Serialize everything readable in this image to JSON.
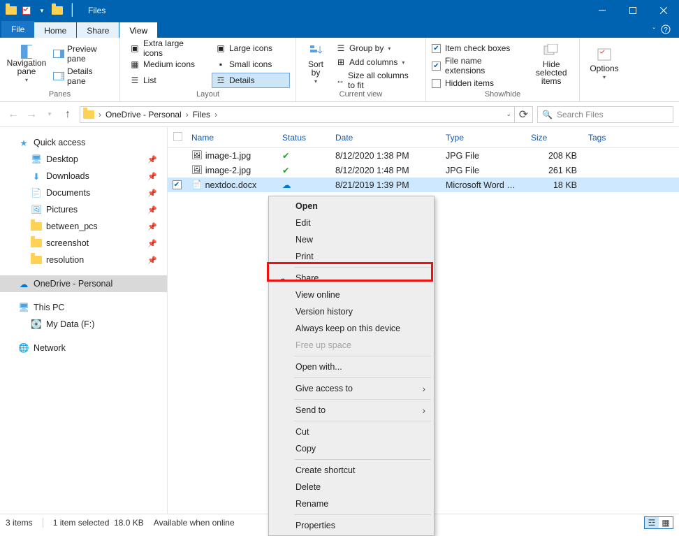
{
  "title": "Files",
  "tabs": {
    "file": "File",
    "home": "Home",
    "share": "Share",
    "view": "View"
  },
  "ribbon": {
    "panes": {
      "nav": "Navigation pane",
      "preview": "Preview pane",
      "details": "Details pane",
      "group": "Panes"
    },
    "layout": {
      "xl": "Extra large icons",
      "l": "Large icons",
      "m": "Medium icons",
      "s": "Small icons",
      "list": "List",
      "details": "Details",
      "group": "Layout"
    },
    "sort": {
      "btn": "Sort by",
      "group": "Current view",
      "groupby": "Group by",
      "addcols": "Add columns",
      "sizeall": "Size all columns to fit"
    },
    "show": {
      "itemcheck": "Item check boxes",
      "ext": "File name extensions",
      "hidden": "Hidden items",
      "hidesel": "Hide selected items",
      "group": "Show/hide"
    },
    "options": "Options"
  },
  "breadcrumb": {
    "root": "OneDrive - Personal",
    "folder": "Files"
  },
  "search": {
    "placeholder": "Search Files"
  },
  "nav": {
    "quick": "Quick access",
    "desktop": "Desktop",
    "downloads": "Downloads",
    "documents": "Documents",
    "pictures": "Pictures",
    "between": "between_pcs",
    "screenshot": "screenshot",
    "resolution": "resolution",
    "onedrive": "OneDrive - Personal",
    "thispc": "This PC",
    "mydata": "My Data (F:)",
    "network": "Network"
  },
  "columns": {
    "name": "Name",
    "status": "Status",
    "date": "Date",
    "type": "Type",
    "size": "Size",
    "tags": "Tags"
  },
  "files": [
    {
      "name": "image-1.jpg",
      "date": "8/12/2020 1:38 PM",
      "type": "JPG File",
      "size": "208 KB",
      "selected": false,
      "icon": "jpg"
    },
    {
      "name": "image-2.jpg",
      "date": "8/12/2020 1:48 PM",
      "type": "JPG File",
      "size": "261 KB",
      "selected": false,
      "icon": "jpg"
    },
    {
      "name": "nextdoc.docx",
      "date": "8/21/2019 1:39 PM",
      "type": "Microsoft Word D...",
      "size": "18 KB",
      "selected": true,
      "icon": "docx"
    }
  ],
  "status": {
    "count": "3 items",
    "sel": "1 item selected",
    "size": "18.0 KB",
    "avail": "Available when online"
  },
  "context_menu": {
    "open": "Open",
    "edit": "Edit",
    "new": "New",
    "print": "Print",
    "share": "Share",
    "view_online": "View online",
    "version": "Version history",
    "always_keep": "Always keep on this device",
    "free_up": "Free up space",
    "open_with": "Open with...",
    "give_access": "Give access to",
    "send_to": "Send to",
    "cut": "Cut",
    "copy": "Copy",
    "create_shortcut": "Create shortcut",
    "delete": "Delete",
    "rename": "Rename",
    "properties": "Properties"
  }
}
